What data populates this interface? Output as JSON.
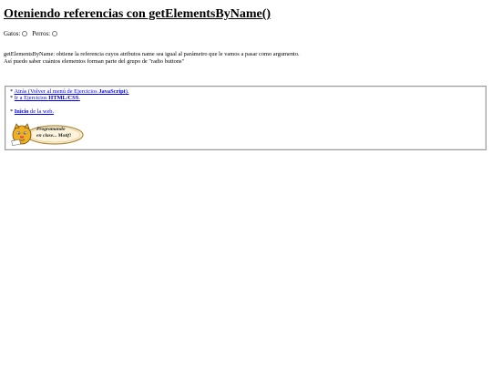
{
  "page": {
    "title": "Oteniendo referencias con getElementsByName()"
  },
  "radios": {
    "gatos_label": "Gatos:",
    "perros_label": "Perros:"
  },
  "description": {
    "line1": "getElementsByName: obtiene la referencia cuyos atributos name sea igual al parámetro que le vamos a pasar como argumento.",
    "line2": "Así puedo saber cuántos elementos forman parte del grupo de \"radio buttons\""
  },
  "nav": {
    "back_prefix": "* ",
    "back_link": "Atrás (Volver al menú de Ejercicios ",
    "back_bold": "JavaScript",
    "back_suffix": ").",
    "html_prefix": "* ",
    "html_link": "Ir a Ejercicios ",
    "html_bold": "HTML/CSS",
    "html_suffix": ".",
    "home_prefix": "* ",
    "home_bold": "Inicio",
    "home_link": " de la web."
  },
  "logo": {
    "line1": "Programando",
    "line2": "en clase... Motif!"
  },
  "colors": {
    "link": "#0000ee",
    "logo_gold": "#f0b020",
    "logo_border": "#b08a3a"
  }
}
